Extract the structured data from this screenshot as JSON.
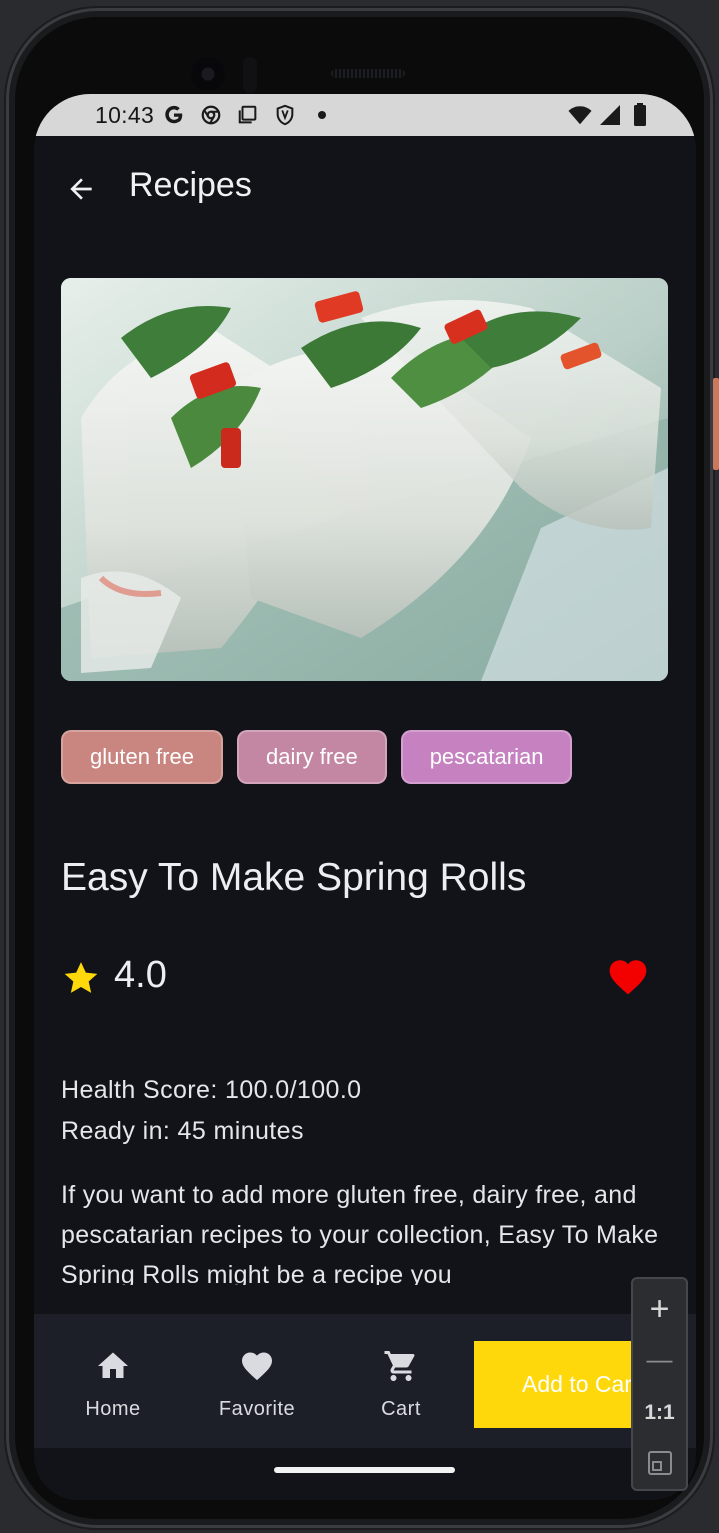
{
  "status_bar": {
    "time": "10:43",
    "left_icons": [
      "google-g-icon",
      "chrome-icon",
      "screenshot-icon",
      "shield-icon",
      "dot-icon"
    ],
    "right_icons": [
      "wifi-icon",
      "signal-icon",
      "battery-icon"
    ]
  },
  "app_bar": {
    "title": "Recipes"
  },
  "recipe": {
    "tags": [
      {
        "label": "gluten free",
        "color": "#c9857f"
      },
      {
        "label": "dairy free",
        "color": "#c487a3"
      },
      {
        "label": "pescatarian",
        "color": "#c681c0"
      }
    ],
    "title": "Easy To Make Spring Rolls",
    "rating": "4.0",
    "rating_value": 4.0,
    "star_color": "#fed80b",
    "favorite_color": "#f30000",
    "health_score": "Health Score: 100.0/100.0",
    "ready_in": "Ready in: 45 minutes",
    "description": "If you want to add more gluten free, dairy free, and pescatarian recipes to your collection, Easy To Make Spring Rolls might be a recipe you"
  },
  "bottom_nav": {
    "items": [
      {
        "label": "Home",
        "icon": "home-icon"
      },
      {
        "label": "Favorite",
        "icon": "heart-icon"
      },
      {
        "label": "Cart",
        "icon": "cart-icon"
      }
    ],
    "add_to_cart": "Add to Cart",
    "accent": "#fed80b"
  },
  "zoom_controls": {
    "zoom_in": "+",
    "zoom_out": "—",
    "actual_size": "1:1"
  }
}
